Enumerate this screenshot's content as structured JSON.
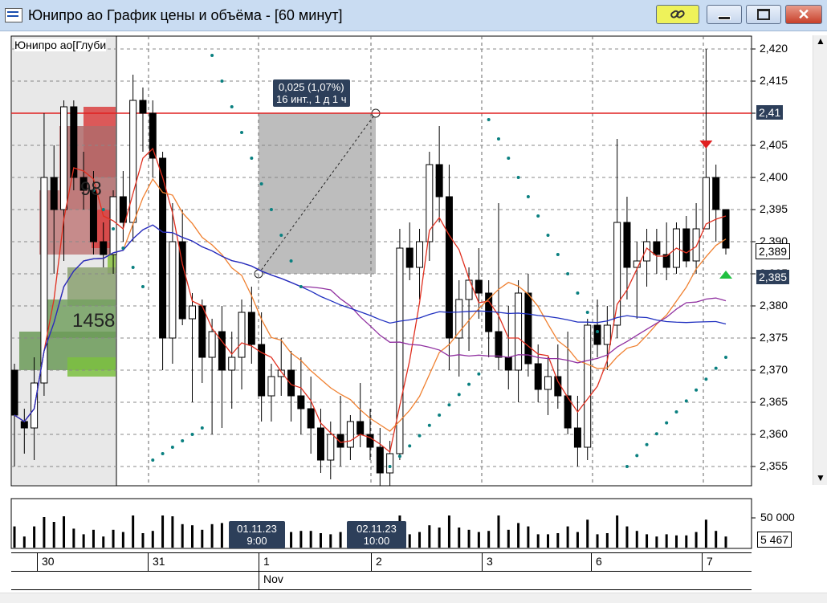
{
  "window": {
    "title": "Юнипро ао График цены и объёма - [60 минут]"
  },
  "chart": {
    "overlay_label": "Юнипро ао[Глуби",
    "measure_line1": "0,025 (1,07%)",
    "measure_line2": "16 инт., 1 д 1 ч",
    "vol_profile_top": "98",
    "vol_profile_bottom": "1458",
    "price_current_1": "2,389",
    "price_current_2": "2,385",
    "price_line": "2,41"
  },
  "price_axis": [
    "2,420",
    "2,415",
    "2,41",
    "2,405",
    "2,400",
    "2,395",
    "2,390",
    "2,385",
    "2,380",
    "2,375",
    "2,370",
    "2,365",
    "2,360",
    "2,355"
  ],
  "volume_axis": {
    "top": "50 000",
    "current": "5 467"
  },
  "time_tags": [
    {
      "l1": "01.11.23",
      "l2": "9:00"
    },
    {
      "l1": "02.11.23",
      "l2": "10:00"
    }
  ],
  "dates": [
    "30",
    "31",
    "1",
    "2",
    "3",
    "6",
    "7"
  ],
  "month": "Nov",
  "chart_data": {
    "type": "candlestick",
    "ylim": [
      2.352,
      2.422
    ],
    "candles": [
      [
        2.37,
        2.371,
        2.355,
        2.363
      ],
      [
        2.362,
        2.364,
        2.357,
        2.361
      ],
      [
        2.361,
        2.372,
        2.356,
        2.368
      ],
      [
        2.368,
        2.41,
        2.366,
        2.4
      ],
      [
        2.4,
        2.405,
        2.385,
        2.395
      ],
      [
        2.395,
        2.412,
        2.387,
        2.411
      ],
      [
        2.411,
        2.412,
        2.398,
        2.4
      ],
      [
        2.4,
        2.404,
        2.395,
        2.398
      ],
      [
        2.398,
        2.401,
        2.388,
        2.39
      ],
      [
        2.39,
        2.393,
        2.386,
        2.388
      ],
      [
        2.388,
        2.398,
        2.385,
        2.397
      ],
      [
        2.397,
        2.401,
        2.39,
        2.393
      ],
      [
        2.393,
        2.416,
        2.39,
        2.412
      ],
      [
        2.412,
        2.414,
        2.404,
        2.41
      ],
      [
        2.41,
        2.412,
        2.4,
        2.403
      ],
      [
        2.403,
        2.404,
        2.37,
        2.375
      ],
      [
        2.375,
        2.396,
        2.371,
        2.39
      ],
      [
        2.39,
        2.395,
        2.377,
        2.378
      ],
      [
        2.378,
        2.382,
        2.365,
        2.38
      ],
      [
        2.38,
        2.381,
        2.368,
        2.372
      ],
      [
        2.372,
        2.378,
        2.36,
        2.376
      ],
      [
        2.376,
        2.38,
        2.361,
        2.37
      ],
      [
        2.37,
        2.376,
        2.364,
        2.372
      ],
      [
        2.372,
        2.381,
        2.367,
        2.379
      ],
      [
        2.379,
        2.383,
        2.371,
        2.374
      ],
      [
        2.374,
        2.379,
        2.362,
        2.366
      ],
      [
        2.366,
        2.371,
        2.362,
        2.369
      ],
      [
        2.369,
        2.375,
        2.366,
        2.37
      ],
      [
        2.37,
        2.373,
        2.362,
        2.366
      ],
      [
        2.366,
        2.372,
        2.36,
        2.364
      ],
      [
        2.364,
        2.369,
        2.357,
        2.361
      ],
      [
        2.361,
        2.364,
        2.354,
        2.356
      ],
      [
        2.356,
        2.362,
        2.353,
        2.36
      ],
      [
        2.36,
        2.366,
        2.355,
        2.358
      ],
      [
        2.358,
        2.363,
        2.356,
        2.362
      ],
      [
        2.362,
        2.368,
        2.358,
        2.36
      ],
      [
        2.36,
        2.364,
        2.356,
        2.358
      ],
      [
        2.358,
        2.361,
        2.352,
        2.354
      ],
      [
        2.354,
        2.359,
        2.352,
        2.357
      ],
      [
        2.357,
        2.392,
        2.356,
        2.389
      ],
      [
        2.389,
        2.393,
        2.384,
        2.386
      ],
      [
        2.386,
        2.392,
        2.381,
        2.39
      ],
      [
        2.39,
        2.404,
        2.387,
        2.402
      ],
      [
        2.402,
        2.408,
        2.393,
        2.397
      ],
      [
        2.397,
        2.402,
        2.37,
        2.375
      ],
      [
        2.375,
        2.384,
        2.369,
        2.381
      ],
      [
        2.381,
        2.386,
        2.373,
        2.384
      ],
      [
        2.384,
        2.389,
        2.378,
        2.382
      ],
      [
        2.382,
        2.384,
        2.372,
        2.376
      ],
      [
        2.376,
        2.396,
        2.37,
        2.372
      ],
      [
        2.372,
        2.38,
        2.367,
        2.37
      ],
      [
        2.37,
        2.384,
        2.365,
        2.382
      ],
      [
        2.382,
        2.385,
        2.369,
        2.371
      ],
      [
        2.371,
        2.374,
        2.365,
        2.367
      ],
      [
        2.367,
        2.372,
        2.363,
        2.369
      ],
      [
        2.369,
        2.374,
        2.364,
        2.366
      ],
      [
        2.366,
        2.376,
        2.36,
        2.361
      ],
      [
        2.361,
        2.366,
        2.355,
        2.358
      ],
      [
        2.358,
        2.378,
        2.356,
        2.377
      ],
      [
        2.377,
        2.381,
        2.372,
        2.374
      ],
      [
        2.374,
        2.38,
        2.37,
        2.377
      ],
      [
        2.377,
        2.406,
        2.375,
        2.393
      ],
      [
        2.393,
        2.397,
        2.381,
        2.386
      ],
      [
        2.386,
        2.39,
        2.378,
        2.387
      ],
      [
        2.387,
        2.392,
        2.383,
        2.39
      ],
      [
        2.39,
        2.392,
        2.385,
        2.388
      ],
      [
        2.388,
        2.393,
        2.384,
        2.386
      ],
      [
        2.386,
        2.393,
        2.385,
        2.392
      ],
      [
        2.392,
        2.394,
        2.386,
        2.387
      ],
      [
        2.387,
        2.396,
        2.385,
        2.392
      ],
      [
        2.392,
        2.42,
        2.398,
        2.4
      ],
      [
        2.4,
        2.402,
        2.39,
        2.395
      ],
      [
        2.395,
        2.395,
        2.388,
        2.389
      ]
    ]
  }
}
